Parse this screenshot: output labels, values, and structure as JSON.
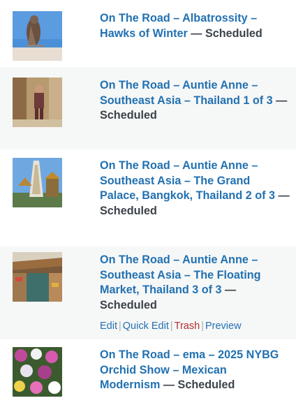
{
  "posts": [
    {
      "title": "On The Road – Albatrossity – Hawks of Winter",
      "state": "Scheduled",
      "thumbnail": "hawk-photo"
    },
    {
      "title": "On The Road – Auntie Anne – Southeast Asia – Thailand 1 of 3",
      "state": "Scheduled",
      "thumbnail": "person-photo"
    },
    {
      "title": "On The Road – Auntie Anne – Southeast Asia – The Grand Palace, Bangkok, Thailand 2 of 3",
      "state": "Scheduled",
      "thumbnail": "temple-photo"
    },
    {
      "title": "On The Road – Auntie Anne – Southeast Asia – The Floating Market, Thailand 3 of 3",
      "state": "Scheduled",
      "thumbnail": "floating-market-photo"
    },
    {
      "title": "On The Road – ema – 2025 NYBG Orchid Show – Mexican Modernism",
      "state": "Scheduled",
      "thumbnail": "orchid-photo"
    }
  ],
  "row_actions": {
    "edit": "Edit",
    "quick_edit": "Quick Edit",
    "trash": "Trash",
    "preview": "Preview",
    "separator": "|"
  },
  "state_separator": "—",
  "colors": {
    "link": "#2271b1",
    "trash": "#b32d2e",
    "state_text": "#3c434a",
    "alt_row": "#f6f7f7"
  }
}
